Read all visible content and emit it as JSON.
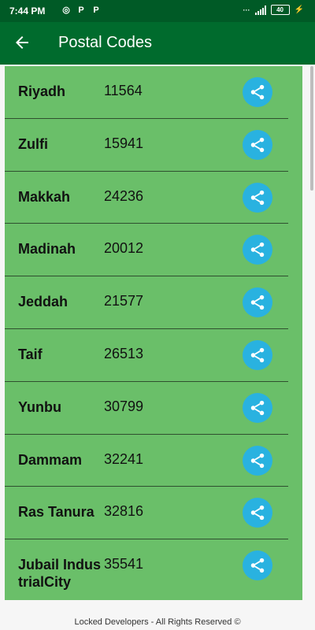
{
  "status": {
    "time": "7:44 PM",
    "battery": "40",
    "icons": [
      "whatsapp-icon",
      "p-icon",
      "p-icon"
    ]
  },
  "appbar": {
    "title": "Postal Codes"
  },
  "rows": [
    {
      "city": "Riyadh",
      "code": "11564"
    },
    {
      "city": "Zulfi",
      "code": "15941"
    },
    {
      "city": "Makkah",
      "code": "24236"
    },
    {
      "city": "Madinah",
      "code": "20012"
    },
    {
      "city": "Jeddah",
      "code": "21577"
    },
    {
      "city": "Taif",
      "code": "26513"
    },
    {
      "city": "Yunbu",
      "code": "30799"
    },
    {
      "city": "Dammam",
      "code": "32241"
    },
    {
      "city": "Ras Tanura",
      "code": "32816"
    },
    {
      "city": "Jubail IndustrialCity",
      "code": "35541"
    }
  ],
  "footer": {
    "text": "Locked Developers - All Rights Reserved ©"
  },
  "colors": {
    "status_bar": "#005a26",
    "app_bar": "#006b2d",
    "list_bg": "#6abf69",
    "share": "#29b2e0"
  }
}
